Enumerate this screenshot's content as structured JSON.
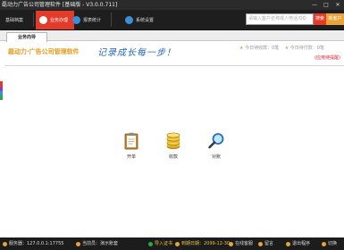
{
  "window": {
    "title": "磊动力广告公司管理软件 [基础版 - V3.0.0.711]",
    "controls": [
      "—",
      "□",
      "✕"
    ]
  },
  "toolbar": {
    "nav": [
      {
        "label": "基础档案",
        "icon": "folder-icon",
        "color": "#3b8fd8"
      },
      {
        "label": "业务办理",
        "icon": "briefcase-icon",
        "color": "#e23b2a",
        "active": true
      },
      {
        "label": "报表统计",
        "icon": "chart-icon",
        "color": "#3b8fd8"
      },
      {
        "label": "系统设置",
        "icon": "gear-icon",
        "color": "#3b8fd8"
      }
    ],
    "search_placeholder": "请输入客户名称或人电话/QQ",
    "search_button": "搜索",
    "customer_button": "新客户"
  },
  "tabs": {
    "active": "业务向导"
  },
  "header": {
    "brand": "磊动力·广告公司管理软件",
    "slogan": "记录成长每一步！",
    "notice_left": "今日待收款：0笔",
    "notice_right": "今日待付款：0笔",
    "notice_link": "(应用待提醒)"
  },
  "actions": [
    {
      "label": "开单",
      "icon": "clipboard-icon"
    },
    {
      "label": "收款",
      "icon": "coins-icon"
    },
    {
      "label": "对账",
      "icon": "magnifier-icon"
    }
  ],
  "status": {
    "server": "服务器：127.0.0.1:17755",
    "user": "当前员：演示账套",
    "import": "导入证书",
    "expire": "到期日期：2099-12-30",
    "online": "在线客服",
    "feedback": "留言",
    "exit_app": "退出程序",
    "switch": "切换"
  },
  "leftbar_colors": [
    "#e23b2a",
    "#8e3dc8",
    "#3b8fd8",
    "#2aa84a",
    "#e8a43a"
  ]
}
